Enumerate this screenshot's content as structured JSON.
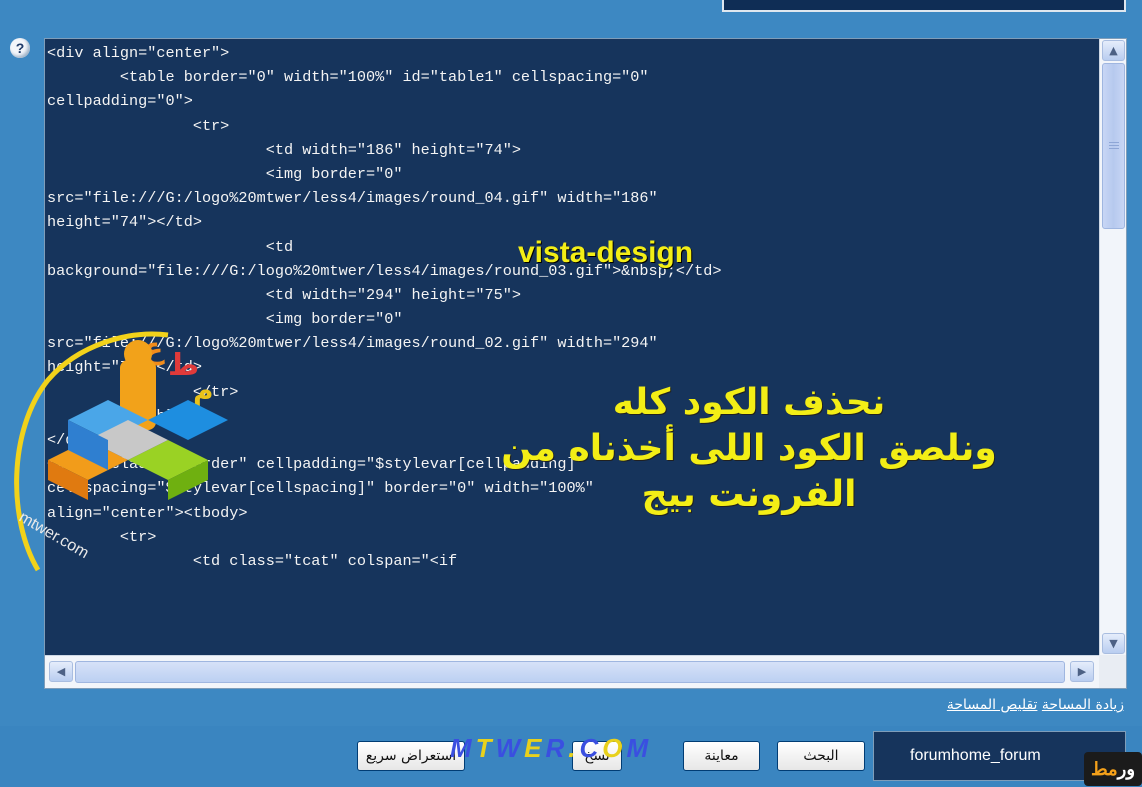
{
  "code_lines": [
    "<div align=\"center\">",
    "        <table border=\"0\" width=\"100%\" id=\"table1\" cellspacing=\"0\"",
    "cellpadding=\"0\">",
    "                <tr>",
    "                        <td width=\"186\" height=\"74\">",
    "                        <img border=\"0\"",
    "src=\"file:///G:/logo%20mtwer/less4/images/round_04.gif\" width=\"186\"",
    "height=\"74\"></td>",
    "                        <td",
    "background=\"file:///G:/logo%20mtwer/less4/images/round_03.gif\">&nbsp;</td>",
    "                        <td width=\"294\" height=\"75\">",
    "                        <img border=\"0\"",
    "src=\"file:///G:/logo%20mtwer/less4/images/round_02.gif\" width=\"294\"",
    "height=\"75\"></td>",
    "                </tr>",
    "        </table>",
    "</div>",
    "<table class=\"tborder\" cellpadding=\"$stylevar[cellpadding]\"",
    "cellspacing=\"$stylevar[cellspacing]\" border=\"0\" width=\"100%\"",
    "align=\"center\"><tbody>",
    "        <tr>",
    "                <td class=\"tcat\" colspan=\"<if"
  ],
  "help": {
    "label": "?"
  },
  "overlay": {
    "english": "vista-design",
    "arabic_line1": "نحذف الكود كله",
    "arabic_line2": "ونلصق الكود اللى أخذناه من",
    "arabic_line3": "الفرونت بيج"
  },
  "links": {
    "increase": "زيادة المساحة",
    "decrease": "تقليص المساحة"
  },
  "buttons": {
    "quick_preview": "استعراض سريع",
    "copy": "نسخ",
    "preview": "معاينة",
    "search": "البحث"
  },
  "template_name": "forumhome_forum",
  "watermark": [
    "M",
    "T",
    "W",
    "E",
    "R",
    ".",
    "C",
    "O",
    "M"
  ],
  "corner_logo": {
    "a": "مط",
    "b": "ور"
  },
  "colors": {
    "page_bg": "#3d88c2",
    "editor_bg": "#16345c",
    "code_text": "#f4f4f4",
    "overlay_text": "#f3ee16"
  }
}
